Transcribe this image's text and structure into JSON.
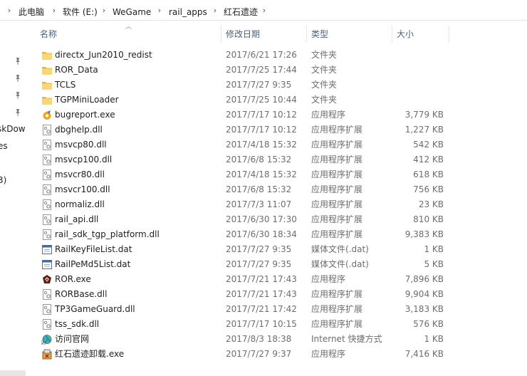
{
  "breadcrumb": [
    {
      "label": "此电脑"
    },
    {
      "label": "软件 (E:)"
    },
    {
      "label": "WeGame"
    },
    {
      "label": "rail_apps"
    },
    {
      "label": "红石遗迹"
    }
  ],
  "nav_fragments": [
    "skDow",
    "es",
    "3)",
    ")"
  ],
  "columns": {
    "name": "名称",
    "date": "修改日期",
    "type": "类型",
    "size": "大小"
  },
  "files": [
    {
      "name": "directx_Jun2010_redist",
      "date": "2017/6/21 17:26",
      "type": "文件夹",
      "size": "",
      "icon": "folder-icon"
    },
    {
      "name": "ROR_Data",
      "date": "2017/7/25 17:44",
      "type": "文件夹",
      "size": "",
      "icon": "folder-icon"
    },
    {
      "name": "TCLS",
      "date": "2017/7/27 9:35",
      "type": "文件夹",
      "size": "",
      "icon": "folder-icon"
    },
    {
      "name": "TGPMiniLoader",
      "date": "2017/7/25 10:44",
      "type": "文件夹",
      "size": "",
      "icon": "folder-icon"
    },
    {
      "name": "bugreport.exe",
      "date": "2017/7/17 10:12",
      "type": "应用程序",
      "size": "3,779 KB",
      "icon": "bugreport-app-icon"
    },
    {
      "name": "dbghelp.dll",
      "date": "2017/7/17 10:12",
      "type": "应用程序扩展",
      "size": "1,227 KB",
      "icon": "dll-file-icon"
    },
    {
      "name": "msvcp80.dll",
      "date": "2017/4/18 15:32",
      "type": "应用程序扩展",
      "size": "542 KB",
      "icon": "dll-file-icon"
    },
    {
      "name": "msvcp100.dll",
      "date": "2017/6/8 15:32",
      "type": "应用程序扩展",
      "size": "412 KB",
      "icon": "dll-file-icon"
    },
    {
      "name": "msvcr80.dll",
      "date": "2017/4/18 15:32",
      "type": "应用程序扩展",
      "size": "618 KB",
      "icon": "dll-file-icon"
    },
    {
      "name": "msvcr100.dll",
      "date": "2017/6/8 15:32",
      "type": "应用程序扩展",
      "size": "756 KB",
      "icon": "dll-file-icon"
    },
    {
      "name": "normaliz.dll",
      "date": "2017/7/3 11:07",
      "type": "应用程序扩展",
      "size": "23 KB",
      "icon": "dll-file-icon"
    },
    {
      "name": "rail_api.dll",
      "date": "2017/6/30 17:30",
      "type": "应用程序扩展",
      "size": "810 KB",
      "icon": "dll-file-icon"
    },
    {
      "name": "rail_sdk_tgp_platform.dll",
      "date": "2017/6/30 18:34",
      "type": "应用程序扩展",
      "size": "9,383 KB",
      "icon": "dll-file-icon"
    },
    {
      "name": "RailKeyFileList.dat",
      "date": "2017/7/27 9:35",
      "type": "媒体文件(.dat)",
      "size": "1 KB",
      "icon": "dat-file-icon"
    },
    {
      "name": "RailPeMd5List.dat",
      "date": "2017/7/27 9:35",
      "type": "媒体文件(.dat)",
      "size": "5 KB",
      "icon": "dat-file-icon"
    },
    {
      "name": "ROR.exe",
      "date": "2017/7/21 17:43",
      "type": "应用程序",
      "size": "7,896 KB",
      "icon": "ror-app-icon"
    },
    {
      "name": "RORBase.dll",
      "date": "2017/7/21 17:43",
      "type": "应用程序扩展",
      "size": "9,904 KB",
      "icon": "dll-file-icon"
    },
    {
      "name": "TP3GameGuard.dll",
      "date": "2017/7/21 17:42",
      "type": "应用程序扩展",
      "size": "3,183 KB",
      "icon": "dll-file-icon"
    },
    {
      "name": "tss_sdk.dll",
      "date": "2017/7/17 10:15",
      "type": "应用程序扩展",
      "size": "576 KB",
      "icon": "dll-file-icon"
    },
    {
      "name": "访问官网",
      "date": "2017/8/3 18:38",
      "type": "Internet 快捷方式",
      "size": "1 KB",
      "icon": "internet-shortcut-icon"
    },
    {
      "name": "红石遗迹卸载.exe",
      "date": "2017/7/27 9:37",
      "type": "应用程序",
      "size": "7,416 KB",
      "icon": "uninstaller-app-icon"
    }
  ],
  "colors": {
    "header_text": "#4c607a",
    "meta_text": "#6d6d6d",
    "folder": "#f8d775",
    "folder_dark": "#e0b94a"
  }
}
